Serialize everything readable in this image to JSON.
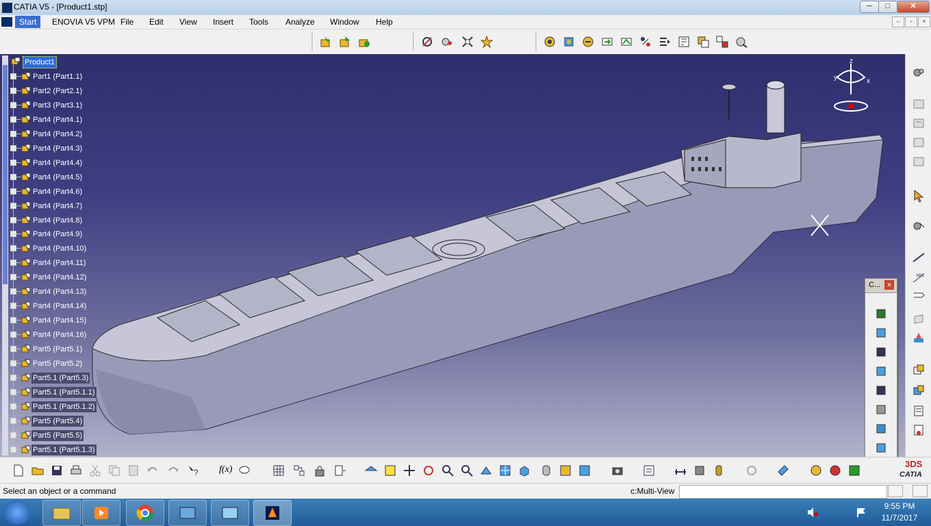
{
  "window": {
    "title": "CATIA V5 - [Product1.stp]",
    "minimize": "─",
    "maximize": "□",
    "close": "✕"
  },
  "menu": {
    "items": [
      "Start",
      "ENOVIA V5 VPM",
      "File",
      "Edit",
      "View",
      "Insert",
      "Tools",
      "Analyze",
      "Window",
      "Help"
    ]
  },
  "tree": {
    "root": "Product1",
    "items": [
      "Part1 (Part1.1)",
      "Part2 (Part2.1)",
      "Part3 (Part3.1)",
      "Part4 (Part4.1)",
      "Part4 (Part4.2)",
      "Part4 (Part4.3)",
      "Part4 (Part4.4)",
      "Part4 (Part4.5)",
      "Part4 (Part4.6)",
      "Part4 (Part4.7)",
      "Part4 (Part4.8)",
      "Part4 (Part4.9)",
      "Part4 (Part4.10)",
      "Part4 (Part4.11)",
      "Part4 (Part4.12)",
      "Part4 (Part4.13)",
      "Part4 (Part4.14)",
      "Part4 (Part4.15)",
      "Part4 (Part4.16)",
      "Part5 (Part5.1)",
      "Part5 (Part5.2)",
      "Part5.1 (Part5.3)",
      "Part5.1 (Part5.1.1)",
      "Part5.1 (Part5.1.2)",
      "Part5 (Part5.4)",
      "Part5 (Part5.5)",
      "Part5.1 (Part5.1.3)"
    ]
  },
  "compass": {
    "x": "x",
    "y": "y",
    "z": "z"
  },
  "palette": {
    "title": "C...",
    "close": "✕"
  },
  "bottom_toolbar": {
    "fx_label": "f(x)"
  },
  "brand": {
    "logo_text": "CATIA",
    "logo_mark": "3DS"
  },
  "status": {
    "message": "Select an object or a command",
    "view_label": "c:Multi-View",
    "command_value": ""
  },
  "taskbar": {
    "time": "9:55 PM",
    "date": "11/7/2017"
  },
  "colors": {
    "viewport_top": "#2f2f6e",
    "viewport_bottom": "#b2b2cc",
    "selection": "#2f6bd6",
    "taskbar": "#1f5c99"
  }
}
